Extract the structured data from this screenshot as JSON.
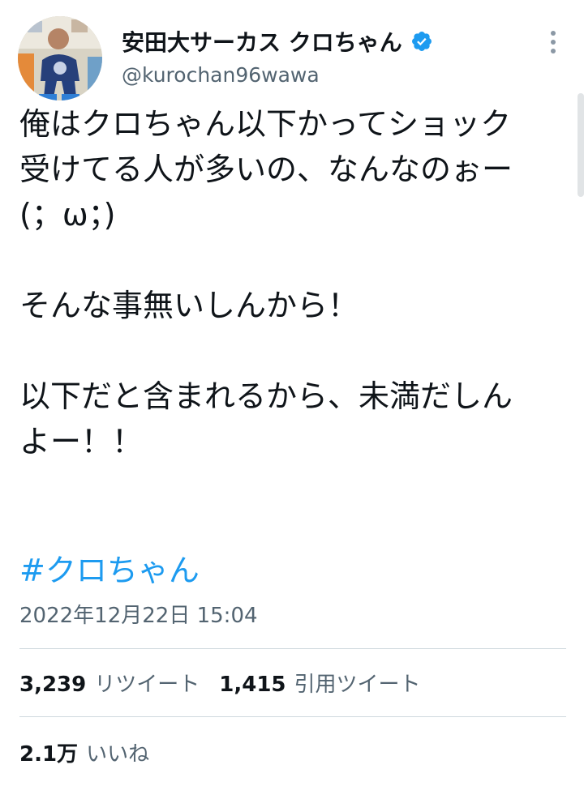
{
  "author": {
    "display_name": "安田大サーカス クロちゃん",
    "handle": "@kurochan96wawa",
    "verified": true
  },
  "tweet": {
    "lines": [
      "俺はクロちゃん以下かってショック",
      "受けてる人が多いの、なんなのぉー",
      "(；ω；)",
      "",
      "そんな事無いしんから！",
      "",
      "以下だと含まれるから、未満だしん",
      "よー！！"
    ],
    "hashtag": "#クロちゃん",
    "timestamp": "2022年12月22日 15:04"
  },
  "stats": {
    "retweets": {
      "count": "3,239",
      "label": "リツイート"
    },
    "quotes": {
      "count": "1,415",
      "label": "引用ツイート"
    },
    "likes": {
      "count": "2.1万",
      "label": "いいね"
    }
  },
  "icons": {
    "verified": "verified-badge-icon",
    "more": "more-options-icon"
  },
  "colors": {
    "text": "#0f1419",
    "secondary": "#536471",
    "link": "#1d9bf0",
    "verified": "#1d9bf0",
    "divider": "#cfd9de"
  }
}
